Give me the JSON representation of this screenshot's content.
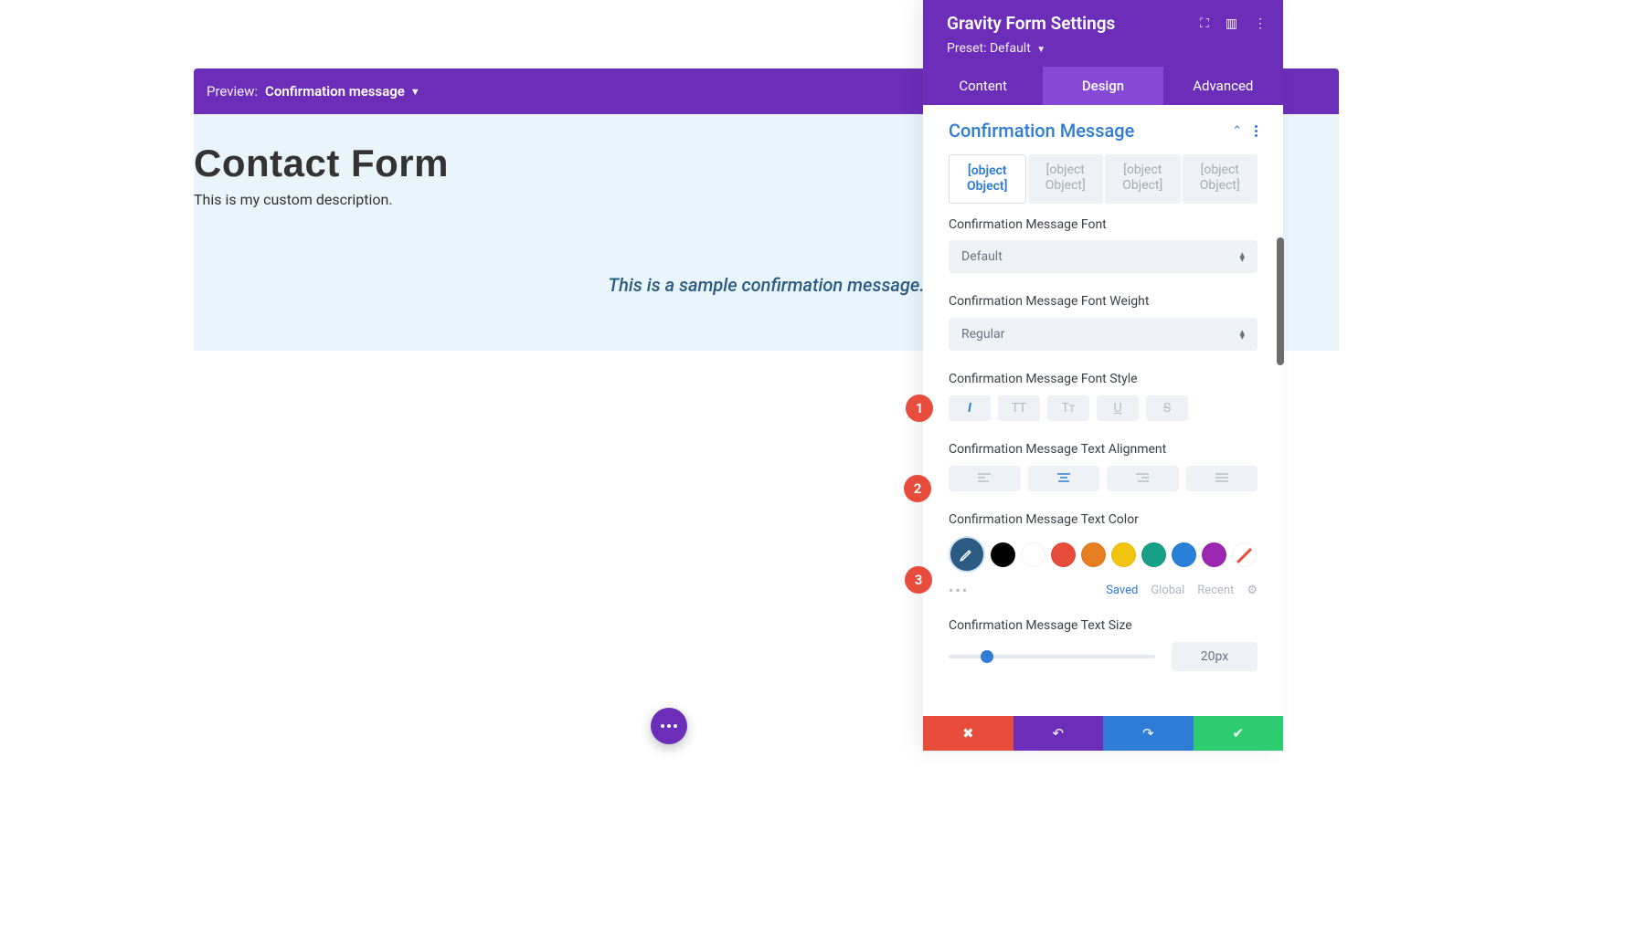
{
  "preview": {
    "label": "Preview:",
    "value": "Confirmation message"
  },
  "form": {
    "title": "Contact Form",
    "description": "This is my custom description.",
    "confirmation": "This is a sample confirmation message."
  },
  "panel": {
    "title": "Gravity Form Settings",
    "preset_label": "Preset:",
    "preset_value": "Default",
    "tabs": [
      "Content",
      "Design",
      "Advanced"
    ],
    "active_tab": "Design",
    "section": "Confirmation Message",
    "sub_tabs": [
      "[object Object]",
      "[object Object]",
      "[object Object]",
      "[object Object]"
    ],
    "settings": {
      "font_label": "Confirmation Message Font",
      "font_value": "Default",
      "weight_label": "Confirmation Message Font Weight",
      "weight_value": "Regular",
      "style_label": "Confirmation Message Font Style",
      "style_buttons": [
        "I",
        "TT",
        "Tт",
        "U",
        "S"
      ],
      "align_label": "Confirmation Message Text Alignment",
      "color_label": "Confirmation Message Text Color",
      "color_current": "#2b5a82",
      "colors": [
        "#000000",
        "#ffffff",
        "#e74c3c",
        "#e67e22",
        "#f1c40f",
        "#16a085",
        "#2980d9",
        "#9b27b0"
      ],
      "color_tabs": {
        "saved": "Saved",
        "global": "Global",
        "recent": "Recent"
      },
      "size_label": "Confirmation Message Text Size",
      "size_value": "20px"
    }
  },
  "markers": {
    "1": "1",
    "2": "2",
    "3": "3"
  }
}
